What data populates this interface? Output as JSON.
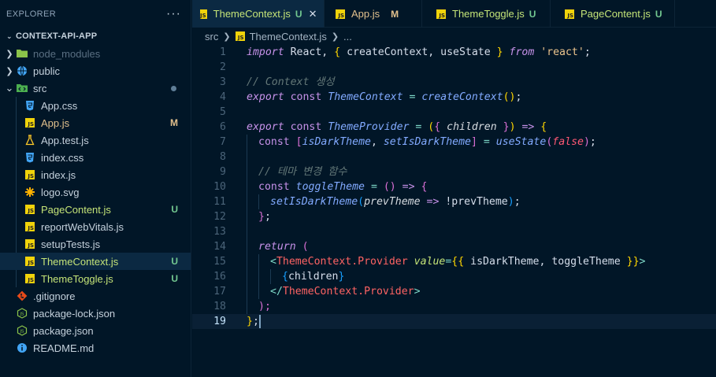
{
  "explorer": {
    "title": "EXPLORER",
    "more": "···",
    "project": "CONTEXT-API-APP",
    "items": [
      {
        "label": "node_modules",
        "status": ""
      },
      {
        "label": "public",
        "status": ""
      },
      {
        "label": "src",
        "status": ""
      },
      {
        "label": "App.css",
        "status": ""
      },
      {
        "label": "App.js",
        "status": "M"
      },
      {
        "label": "App.test.js",
        "status": ""
      },
      {
        "label": "index.css",
        "status": ""
      },
      {
        "label": "index.js",
        "status": ""
      },
      {
        "label": "logo.svg",
        "status": ""
      },
      {
        "label": "PageContent.js",
        "status": "U"
      },
      {
        "label": "reportWebVitals.js",
        "status": ""
      },
      {
        "label": "setupTests.js",
        "status": ""
      },
      {
        "label": "ThemeContext.js",
        "status": "U"
      },
      {
        "label": "ThemeToggle.js",
        "status": "U"
      },
      {
        "label": ".gitignore",
        "status": ""
      },
      {
        "label": "package-lock.json",
        "status": ""
      },
      {
        "label": "package.json",
        "status": ""
      },
      {
        "label": "README.md",
        "status": ""
      }
    ]
  },
  "tabs": [
    {
      "label": "ThemeContext.js",
      "status": "U",
      "close": "✕"
    },
    {
      "label": "App.js",
      "status": "M"
    },
    {
      "label": "ThemeToggle.js",
      "status": "U"
    },
    {
      "label": "PageContent.js",
      "status": "U"
    }
  ],
  "breadcrumb": {
    "folder": "src",
    "file": "ThemeContext.js",
    "ellipsis": "..."
  },
  "editor": {
    "line_numbers": [
      "1",
      "2",
      "3",
      "4",
      "5",
      "6",
      "7",
      "8",
      "9",
      "10",
      "11",
      "12",
      "13",
      "14",
      "15",
      "16",
      "17",
      "18",
      "19"
    ],
    "tokens": {
      "l1": [
        "import",
        " React, ",
        "{",
        " createContext, useState ",
        "}",
        " from",
        " ",
        "'react'",
        ";"
      ],
      "l3": "// Context 생성",
      "l4": [
        "export",
        " ",
        "const",
        " ",
        "ThemeContext",
        " = ",
        "createContext",
        "()",
        ";"
      ],
      "l6": [
        "export",
        " ",
        "const",
        " ",
        "ThemeProvider",
        " = ",
        "(",
        "{",
        " children ",
        "}",
        ")",
        " => ",
        "{"
      ],
      "l7": [
        "const",
        " ",
        "[",
        "isDarkTheme",
        ", ",
        "setIsDarkTheme",
        "]",
        " = ",
        "useState",
        "(",
        "false",
        ")",
        ";"
      ],
      "l9": "// 테마 변경 함수",
      "l10": [
        "const",
        " ",
        "toggleTheme",
        " = ",
        "()",
        " => ",
        "{"
      ],
      "l11": [
        "setIsDarkTheme",
        "(",
        "prevTheme",
        " => ",
        "!prevTheme",
        ")",
        ";"
      ],
      "l12": [
        "}",
        ";"
      ],
      "l14": [
        "return",
        " ("
      ],
      "l15": [
        "<",
        "ThemeContext.Provider",
        " ",
        "value",
        "=",
        "{{",
        " isDarkTheme, toggleTheme ",
        "}}",
        ">"
      ],
      "l16": [
        "{",
        "children",
        "}"
      ],
      "l17": [
        "</",
        "ThemeContext.Provider",
        ">"
      ],
      "l18": [
        ");"
      ],
      "l19": [
        "}",
        ";"
      ]
    }
  },
  "colors": {
    "background": "#011627",
    "keyword": "#c792ea",
    "function": "#82aaff",
    "string": "#ecc48d",
    "comment": "#637777",
    "untracked": "#73c991",
    "modified": "#e2c08d"
  }
}
